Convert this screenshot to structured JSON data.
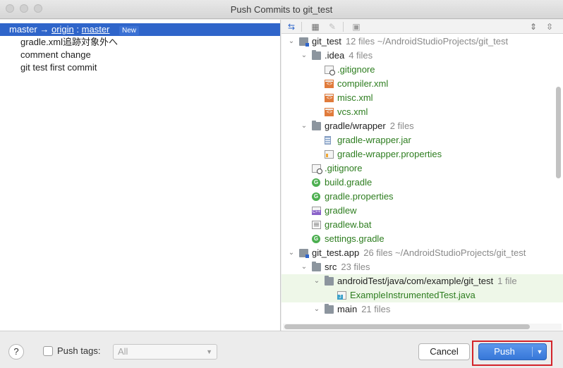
{
  "window": {
    "title": "Push Commits to git_test"
  },
  "commits_panel": {
    "branch": {
      "local": "master",
      "arrow": "→",
      "remote": "origin",
      "sep": ":",
      "remote_branch": "master",
      "badge": "New"
    },
    "commits": [
      "gradle.xml追跡対象外へ",
      "comment change",
      "git test first commit"
    ]
  },
  "toolbar": {
    "icons": [
      "expand-diff-icon",
      "group-by-icon",
      "edit-icon",
      "preview-icon",
      "expand-all-icon",
      "collapse-all-icon"
    ]
  },
  "tree": [
    {
      "level": 0,
      "expanded": true,
      "icon": "module",
      "name": "git_test",
      "meta": "12 files  ~/AndroidStudioProjects/git_test",
      "color": "default"
    },
    {
      "level": 1,
      "expanded": true,
      "icon": "folder",
      "name": ".idea",
      "meta": "4 files",
      "color": "default"
    },
    {
      "level": 2,
      "icon": "gitignore",
      "name": ".gitignore",
      "color": "green"
    },
    {
      "level": 2,
      "icon": "xml",
      "name": "compiler.xml",
      "color": "green"
    },
    {
      "level": 2,
      "icon": "xml",
      "name": "misc.xml",
      "color": "green"
    },
    {
      "level": 2,
      "icon": "xml",
      "name": "vcs.xml",
      "color": "green"
    },
    {
      "level": 1,
      "expanded": true,
      "icon": "folder",
      "name": "gradle/wrapper",
      "meta": "2 files",
      "color": "default"
    },
    {
      "level": 2,
      "icon": "jar",
      "name": "gradle-wrapper.jar",
      "color": "green"
    },
    {
      "level": 2,
      "icon": "properties",
      "name": "gradle-wrapper.properties",
      "color": "green"
    },
    {
      "level": 1,
      "icon": "gitignore",
      "name": ".gitignore",
      "color": "green"
    },
    {
      "level": 1,
      "icon": "gradle",
      "name": "build.gradle",
      "color": "green"
    },
    {
      "level": 1,
      "icon": "gradle",
      "name": "gradle.properties",
      "color": "green"
    },
    {
      "level": 1,
      "icon": "cpp",
      "name": "gradlew",
      "color": "green"
    },
    {
      "level": 1,
      "icon": "bat",
      "name": "gradlew.bat",
      "color": "green"
    },
    {
      "level": 1,
      "icon": "gradle",
      "name": "settings.gradle",
      "color": "green"
    },
    {
      "level": 0,
      "expanded": true,
      "icon": "module",
      "name": "git_test.app",
      "meta": "26 files  ~/AndroidStudioProjects/git_test",
      "color": "default"
    },
    {
      "level": 1,
      "expanded": true,
      "icon": "folder",
      "name": "src",
      "meta": "23 files",
      "color": "default"
    },
    {
      "level": 2,
      "expanded": true,
      "icon": "folder",
      "name": "androidTest/java/com/example/git_test",
      "meta": "1 file",
      "color": "default",
      "highlight": true
    },
    {
      "level": 3,
      "icon": "java",
      "name": "ExampleInstrumentedTest.java",
      "color": "green",
      "highlight": true
    },
    {
      "level": 2,
      "expanded": true,
      "icon": "folder",
      "name": "main",
      "meta": "21 files",
      "color": "default"
    }
  ],
  "bottom": {
    "help_label": "?",
    "push_tags_label": "Push tags:",
    "push_tags_checked": false,
    "tags_select_value": "All",
    "cancel_label": "Cancel",
    "push_label": "Push"
  },
  "colors": {
    "accent": "#2f65ca",
    "highlight_box": "#d3242a",
    "added_file": "#2d7d1f"
  }
}
